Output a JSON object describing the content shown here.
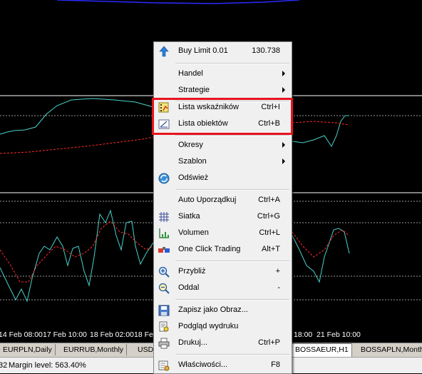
{
  "colors": {
    "background": "#000000",
    "highlight_box": "#e8141e",
    "indicator_main": "#48d1cc",
    "indicator_signal": "#ff2a2a"
  },
  "time_axis": [
    "14 Feb 08:00",
    "17 Feb 10:00",
    "18 Feb 02:00",
    "18 Fe",
    "18:00",
    "21 Feb 10:00"
  ],
  "tabs": [
    "EURPLN,Daily",
    "EURRUB,Monthly",
    "USD",
    "BOSSAEUR,H1",
    "BOSSAPLN,Month"
  ],
  "status": {
    "left": "32",
    "margin_level": "Margin level: 563.40%"
  },
  "menu": {
    "buy_limit": {
      "label": "Buy Limit 0.01",
      "shortcut": "130.738",
      "icon": "up-arrow-icon"
    },
    "handel": {
      "label": "Handel"
    },
    "strategie": {
      "label": "Strategie"
    },
    "lista_wskaznikow": {
      "label": "Lista wskaźników",
      "shortcut": "Ctrl+I",
      "icon": "indicator-list-icon"
    },
    "lista_obiektow": {
      "label": "Lista obiektów",
      "shortcut": "Ctrl+B",
      "icon": "object-list-icon"
    },
    "okresy": {
      "label": "Okresy"
    },
    "szablon": {
      "label": "Szablon"
    },
    "odswiez": {
      "label": "Odśwież",
      "icon": "refresh-icon"
    },
    "auto_uporzadkuj": {
      "label": "Auto Uporządkuj",
      "shortcut": "Ctrl+A"
    },
    "siatka": {
      "label": "Siatka",
      "shortcut": "Ctrl+G",
      "icon": "grid-icon"
    },
    "volumen": {
      "label": "Volumen",
      "shortcut": "Ctrl+L",
      "icon": "volume-icon"
    },
    "one_click": {
      "label": "One Click Trading",
      "shortcut": "Alt+T",
      "icon": "one-click-trading-icon"
    },
    "przybliz": {
      "label": "Przybliż",
      "shortcut": "+",
      "icon": "zoom-in-icon"
    },
    "oddal": {
      "label": "Oddal",
      "shortcut": "-",
      "icon": "zoom-out-icon"
    },
    "zapisz": {
      "label": "Zapisz jako Obraz...",
      "icon": "save-image-icon"
    },
    "podglad": {
      "label": "Podgląd wydruku",
      "icon": "print-preview-icon"
    },
    "drukuj": {
      "label": "Drukuj...",
      "shortcut": "Ctrl+P",
      "icon": "printer-icon"
    },
    "wlasciwosci": {
      "label": "Właściwości...",
      "shortcut": "F8",
      "icon": "properties-icon"
    }
  }
}
